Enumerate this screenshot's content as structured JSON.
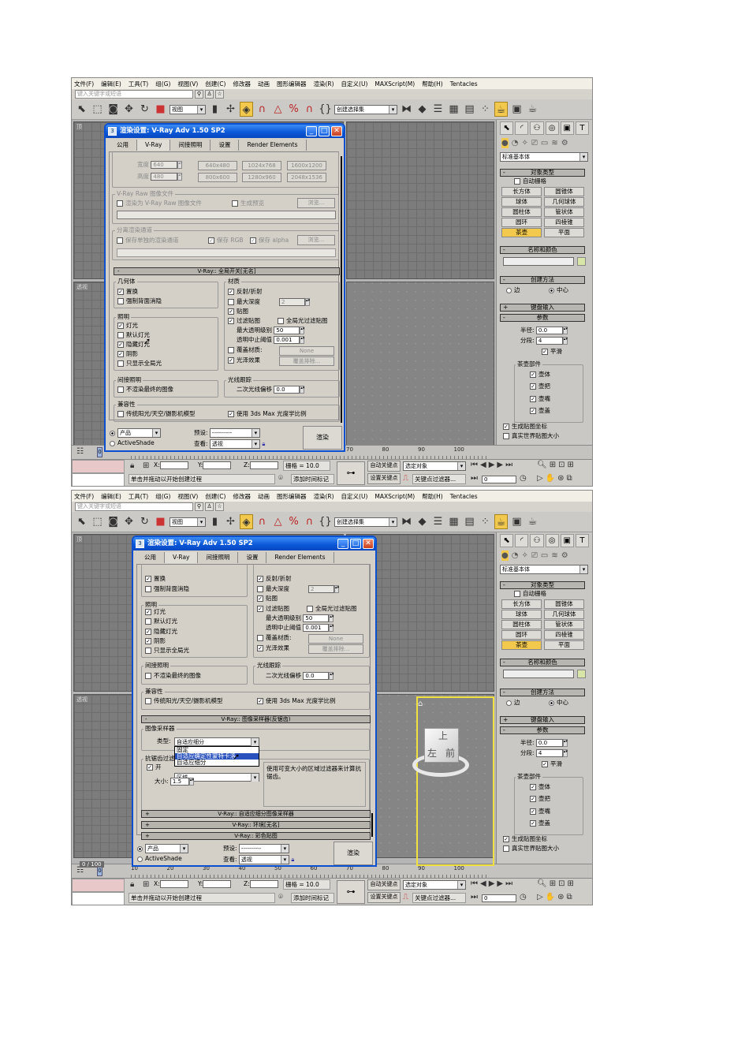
{
  "app": {
    "menu": [
      "文件(F)",
      "编辑(E)",
      "工具(T)",
      "组(G)",
      "视图(V)",
      "创建(C)",
      "修改器",
      "动画",
      "图形编辑器",
      "渲染(R)",
      "自定义(U)",
      "MAXScript(M)",
      "帮助(H)",
      "Tentacles"
    ],
    "search_placeholder": "键入关键字或短语",
    "toolbar": {
      "view_dropdown": "视图",
      "selection_set": "创建选择集"
    },
    "viewports": {
      "top": "顶",
      "perspective": "透视"
    },
    "viewcube": {
      "top": "上",
      "left": "左",
      "front": "前"
    },
    "command_panel": {
      "category": "标准基本体",
      "object_type_title": "对象类型",
      "auto_grid": "自动栅格",
      "buttons": [
        "长方体",
        "圆锥体",
        "球体",
        "几何球体",
        "圆柱体",
        "管状体",
        "圆环",
        "四棱锥",
        "茶壶",
        "平面"
      ],
      "active_button": "茶壶",
      "name_color_title": "名称和颜色",
      "creation_method_title": "创建方法",
      "edge": "边",
      "center": "中心",
      "keyboard_entry": "键盘输入",
      "params_title": "参数",
      "radius_label": "半径:",
      "radius": "0.0",
      "segments_label": "分段:",
      "segments": "4",
      "smooth": "平滑",
      "parts_title": "茶壶部件",
      "parts": [
        "壶体",
        "壶把",
        "壶嘴",
        "壶盖"
      ],
      "gen_map": "生成贴图坐标",
      "real_world": "真实世界贴图大小"
    },
    "timeline": {
      "ticks": [
        "10",
        "20",
        "30",
        "40",
        "50",
        "60",
        "70",
        "80",
        "90",
        "100"
      ],
      "slider": "0",
      "frame_counter": "0 / 100"
    },
    "status": {
      "x": "X:",
      "y": "Y:",
      "z": "Z:",
      "grid": "栅格 = 10.0",
      "auto_key": "自动关键点",
      "set_key": "设置关键点",
      "selected": "选定对象",
      "key_filters": "关键点过滤器...",
      "prompt": "单击并拖动以开始创建过程",
      "add_time_tag": "添加时间标记",
      "frame": "0"
    }
  },
  "dialog": {
    "title": "渲染设置: V-Ray Adv 1.50 SP2",
    "tabs": [
      "公用",
      "V-Ray",
      "间接照明",
      "设置",
      "Render Elements"
    ],
    "output_size": {
      "width_label": "宽度",
      "width": "640",
      "height_label": "高度",
      "height": "480",
      "presets": [
        "640x480",
        "1024x768",
        "1600x1200",
        "800x600",
        "1280x960",
        "2048x1536"
      ]
    },
    "raw": {
      "legend": "V-Ray Raw 图像文件",
      "render_raw": "渲染为 V-Ray Raw 图像文件",
      "preview": "生成预览",
      "browse": "浏览..."
    },
    "split": {
      "legend": "分离渲染通道",
      "save_separate": "保存单独的渲染通道",
      "save_rgb": "保存 RGB",
      "save_alpha": "保存 alpha",
      "browse": "浏览..."
    },
    "global_switches": {
      "title": "V-Ray:: 全局开关[无名]",
      "geometry": "几何体",
      "displacement": "置换",
      "force_backface": "强制背面消隐",
      "lighting": "照明",
      "lights": "灯光",
      "default_lights": "默认灯光",
      "hidden_lights": "隐藏灯光",
      "shadows": "阴影",
      "show_gi_only": "只显示全局光",
      "indirect": "间接照明",
      "dont_render_final": "不渲染最终的图像",
      "materials": "材质",
      "refl_refr": "反射/折射",
      "max_depth": "最大深度",
      "max_depth_val": "2",
      "maps": "贴图",
      "filter_maps": "过滤贴图",
      "filter_maps_gi": "全局光过滤贴图",
      "max_transp": "最大透明级别",
      "max_transp_val": "50",
      "transp_cutoff": "透明中止阈值",
      "transp_cutoff_val": "0.001",
      "override_mtl": "覆盖材质:",
      "override_val": "None",
      "glossy": "光泽效果",
      "override_exclude": "覆盖排除...",
      "raytracing": "光线跟踪",
      "secondary_bias": "二次光线偏移",
      "secondary_bias_val": "0.0",
      "compat": "兼容性",
      "legacy_sun": "传统阳光/天空/摄影机模型",
      "use_photometric": "使用 3ds Max 光度学比例"
    },
    "image_sampler": {
      "title": "V-Ray:: 图像采样器(反锯齿)",
      "legend": "图像采样器",
      "type_label": "类型:",
      "type": "自适应细分",
      "options": [
        "固定",
        "自适应确定性蒙特卡洛",
        "自适应细分"
      ],
      "highlighted_option": 1,
      "aa_legend": "抗锯齿过滤器",
      "on": "开",
      "filter": "区域",
      "size_label": "大小:",
      "size": "1.5",
      "description": "使用可变大小的区域过滤器来计算抗锯齿。"
    },
    "collapsed_rollouts": [
      "V-Ray:: 自适应细分图像采样器",
      "V-Ray:: 环境[无名]",
      "V-Ray:: 彩色贴图"
    ],
    "bottom": {
      "production": "产品",
      "activeshade": "ActiveShade",
      "preset_label": "预设:",
      "preset": "----------",
      "view_label": "查看:",
      "view": "透视",
      "render": "渲染"
    }
  },
  "checks": {
    "displacement": true,
    "force_backface": false,
    "lights": true,
    "default_lights": false,
    "hidden_lights": true,
    "shadows": true,
    "show_gi_only": false,
    "dont_render_final": false,
    "refl_refr": true,
    "max_depth": false,
    "maps": true,
    "filter_maps": true,
    "filter_maps_gi": false,
    "override_mtl": false,
    "glossy": true,
    "legacy_sun": false,
    "use_photometric": true,
    "render_raw": false,
    "preview": false,
    "save_separate": false,
    "save_rgb": true,
    "save_alpha": true,
    "aa_on": true,
    "auto_grid": false,
    "smooth": true,
    "gen_map": true,
    "real_world": false
  }
}
